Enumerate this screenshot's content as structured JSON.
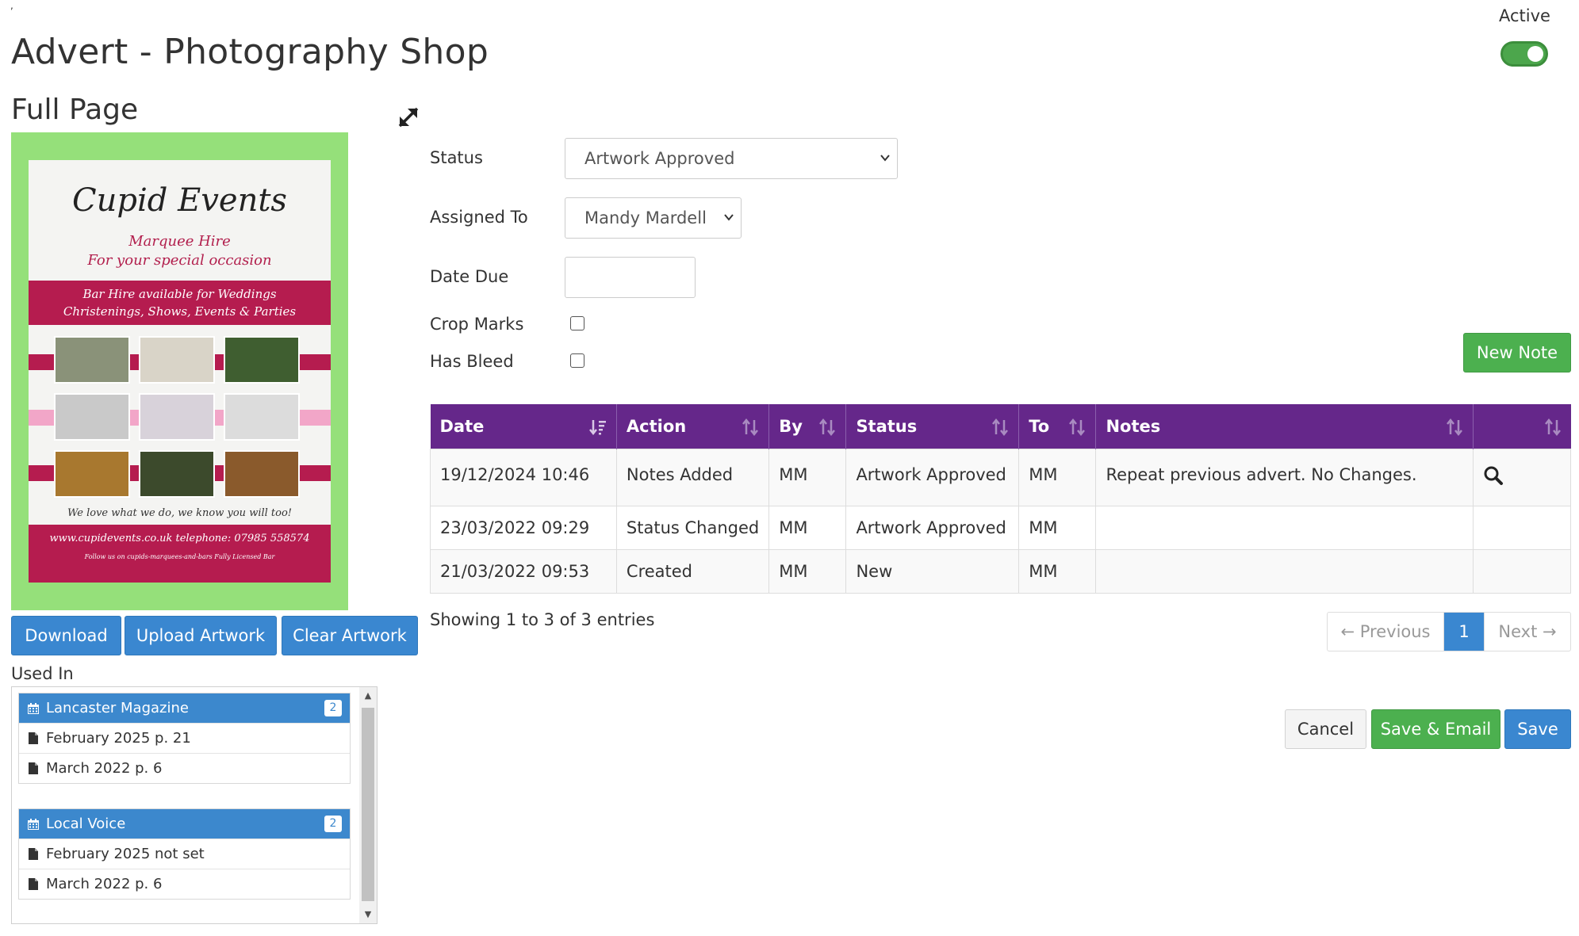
{
  "page": {
    "title": "Advert - Photography Shop",
    "subtitle": "Full Page",
    "active_label": "Active",
    "active_on": true
  },
  "artwork": {
    "logo_text": "Cupid Events",
    "line1": "Marquee Hire",
    "line2": "For your special occasion",
    "band_line1": "Bar Hire available for Weddings",
    "band_line2": "Christenings, Shows, Events & Parties",
    "tagline": "We love what we do, we know you will too!",
    "footer_line1": "www.cupidevents.co.uk   telephone: 07985 558574",
    "footer_line2": "Follow us on  cupids-marquees-and-bars    Fully Licensed Bar"
  },
  "actions": {
    "download": "Download",
    "upload": "Upload Artwork",
    "clear": "Clear Artwork"
  },
  "used_in": {
    "label": "Used In",
    "publications": [
      {
        "name": "Lancaster Magazine",
        "count": "2",
        "issues": [
          "February 2025 p. 21",
          "March 2022 p. 6"
        ]
      },
      {
        "name": "Local Voice",
        "count": "2",
        "issues": [
          "February 2025 not set",
          "March 2022 p. 6"
        ]
      }
    ]
  },
  "form": {
    "status_label": "Status",
    "status_value": "Artwork Approved",
    "assigned_label": "Assigned To",
    "assigned_value": "Mandy Mardell",
    "date_due_label": "Date Due",
    "date_due_value": "",
    "crop_marks_label": "Crop Marks",
    "has_bleed_label": "Has Bleed"
  },
  "notes": {
    "new_note": "New Note",
    "columns": [
      "Date",
      "Action",
      "By",
      "Status",
      "To",
      "Notes",
      ""
    ],
    "rows": [
      [
        "19/12/2024 10:46",
        "Notes Added",
        "MM",
        "Artwork Approved",
        "MM",
        "Repeat previous advert. No Changes."
      ],
      [
        "23/03/2022 09:29",
        "Status Changed",
        "MM",
        "Artwork Approved",
        "MM",
        ""
      ],
      [
        "21/03/2022 09:53",
        "Created",
        "MM",
        "New",
        "MM",
        ""
      ]
    ],
    "showing": "Showing 1 to 3 of 3 entries",
    "prev": "← Previous",
    "page": "1",
    "next": "Next →"
  },
  "footer_buttons": {
    "cancel": "Cancel",
    "save_email": "Save & Email",
    "save": "Save"
  },
  "colors": {
    "header_purple": "#65278a",
    "primary_blue": "#3a87d0",
    "success_green": "#4cb04f",
    "artwork_frame": "#95e07a"
  },
  "icons": {
    "expand": "expand-icon",
    "calendar": "calendar-icon",
    "document": "document-icon",
    "search": "search-icon",
    "sort": "sort-icon"
  }
}
